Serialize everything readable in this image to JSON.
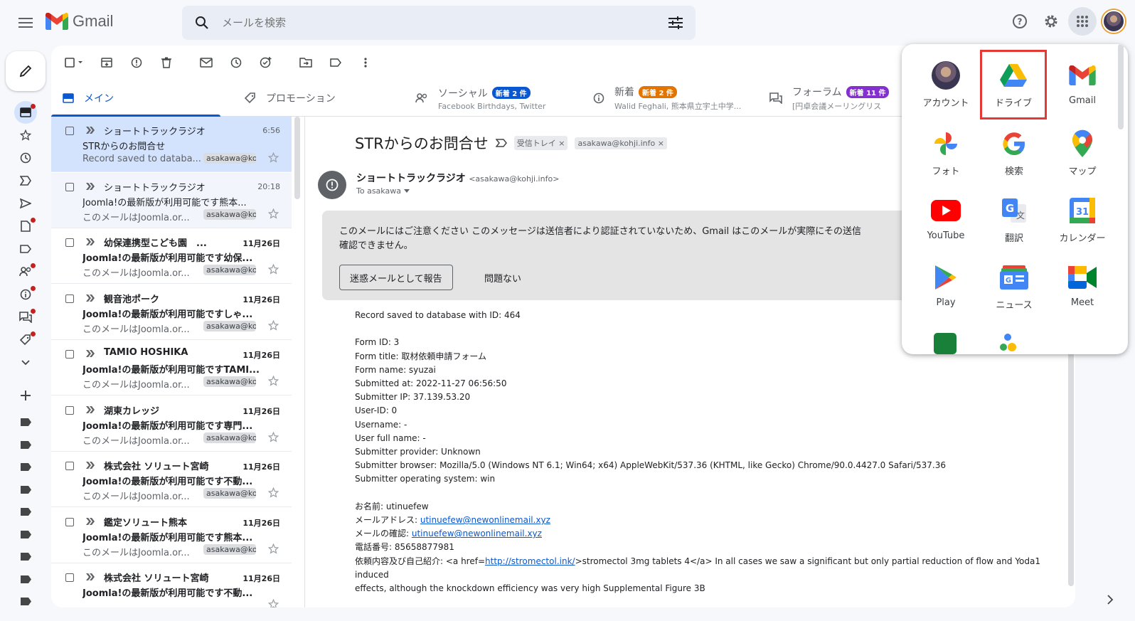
{
  "app": {
    "name": "Gmail"
  },
  "search": {
    "placeholder": "メールを検索"
  },
  "tabs": [
    {
      "title": "メイン",
      "sub": "",
      "badge": ""
    },
    {
      "title": "プロモーション",
      "sub": "",
      "badge": ""
    },
    {
      "title": "ソーシャル",
      "sub": "Facebook Birthdays, Twitter",
      "badge": "新着 2 件"
    },
    {
      "title": "新着",
      "sub": "Walid Feghali, 熊本県立宇土中学...",
      "badge": "新着 2 件"
    },
    {
      "title": "フォーラム",
      "sub": "[円卓会議メーリングリス",
      "badge": "新着 11 件"
    }
  ],
  "colors": {
    "badge_blue": "#0b57d0",
    "badge_orange": "#e37400",
    "badge_purple": "#8430ce",
    "highlight": "#e53935"
  },
  "emails": [
    {
      "sender": "ショートトラックラジオ",
      "time": "6:56",
      "subject": "STRからのお問合せ",
      "snippet": "Record saved to databa...",
      "chip": "asakawa@koji",
      "state": "selected"
    },
    {
      "sender": "ショートトラックラジオ",
      "time": "20:18",
      "subject": "Joomla!の最新版が利用可能です熊本...",
      "snippet": "このメールはJoomla.or...",
      "chip": "asakawa@koji",
      "state": "read"
    },
    {
      "sender": "幼保連携型こども園　...",
      "time": "11月26日",
      "subject": "Joomla!の最新版が利用可能です幼保...",
      "snippet": "このメールはJoomla.or...",
      "chip": "asakawa@koji",
      "state": "unread"
    },
    {
      "sender": "観音池ポーク",
      "time": "11月26日",
      "subject": "Joomla!の最新版が利用可能ですしゃ...",
      "snippet": "このメールはJoomla.or...",
      "chip": "asakawa@koji",
      "state": "unread"
    },
    {
      "sender": "TAMIO HOSHIKA",
      "time": "11月26日",
      "subject": "Joomla!の最新版が利用可能ですTAMI...",
      "snippet": "このメールはJoomla.or...",
      "chip": "asakawa@koji",
      "state": "unread"
    },
    {
      "sender": "湖東カレッジ",
      "time": "11月26日",
      "subject": "Joomla!の最新版が利用可能です専門...",
      "snippet": "このメールはJoomla.or...",
      "chip": "asakawa@koji",
      "state": "unread"
    },
    {
      "sender": "株式会社 ソリュート宮崎",
      "time": "11月26日",
      "subject": "Joomla!の最新版が利用可能です不動...",
      "snippet": "このメールはJoomla.or...",
      "chip": "asakawa@koji",
      "state": "unread"
    },
    {
      "sender": "鑑定ソリュート熊本",
      "time": "11月26日",
      "subject": "Joomla!の最新版が利用可能です熊本...",
      "snippet": "このメールはJoomla.or...",
      "chip": "asakawa@koji",
      "state": "unread"
    },
    {
      "sender": "株式会社 ソリュート宮崎",
      "time": "11月26日",
      "subject": "Joomla!の最新版が利用可能です不動...",
      "snippet": "",
      "chip": "",
      "state": "unread"
    }
  ],
  "message": {
    "title": "STRからのお問合せ",
    "labels": [
      "受信トレイ ×",
      "asakawa@kohji.info ×"
    ],
    "sender_name": "ショートトラックラジオ",
    "sender_email": "<asakawa@kohji.info>",
    "to": "To asakawa",
    "warning_line1": "このメールにはご注意ください このメッセージは送信者により認証されていないため、Gmail はこのメールが実際にその送信",
    "warning_line2": "確認できません。",
    "report_button": "迷惑メールとして報告",
    "ok_button": "問題ない",
    "body": {
      "l1": "Record saved to database with ID:  464",
      "l2": "Form ID: 3",
      "l3": "Form title: 取材依頼申請フォーム",
      "l4": "Form name: syuzai",
      "l5": "Submitted at: 2022-11-27 06:56:50",
      "l6": "Submitter IP: 37.139.53.20",
      "l7": "User-ID: 0",
      "l8": "Username: -",
      "l9": "User full name: -",
      "l10": "Submitter provider: Unknown",
      "l11": "Submitter browser: Mozilla/5.0 (Windows NT 6.1; Win64; x64) AppleWebKit/537.36 (KHTML, like Gecko) Chrome/90.0.4427.0 Safari/537.36",
      "l12": "Submitter operating system: win",
      "l13": "お名前: utinuefew",
      "l14_label": "メールアドレス: ",
      "l14_link": "utinuefew@newonlinemail.xyz",
      "l15_label": "メールの確認: ",
      "l15_link": "utinuefew@newonlinemail.xyz",
      "l16": "電話番号: 85658877981",
      "l17_a": "依頼内容及び自己紹介: <a href=",
      "l17_link": "http://stromectol.ink/",
      "l17_b": ">stromectol 3mg tablets 4</a> In all cases we saw a significant but only partial reduction of flow and Yoda1 induced",
      "l18": "effects, although the knockdown efficiency was very high Supplemental Figure 3B"
    }
  },
  "apps": [
    {
      "label": "アカウント",
      "icon": "account-icon"
    },
    {
      "label": "ドライブ",
      "icon": "drive-icon"
    },
    {
      "label": "Gmail",
      "icon": "gmail-icon"
    },
    {
      "label": "フォト",
      "icon": "photos-icon"
    },
    {
      "label": "検索",
      "icon": "google-search-icon"
    },
    {
      "label": "マップ",
      "icon": "maps-icon"
    },
    {
      "label": "YouTube",
      "icon": "youtube-icon"
    },
    {
      "label": "翻訳",
      "icon": "translate-icon"
    },
    {
      "label": "カレンダー",
      "icon": "calendar-icon"
    },
    {
      "label": "Play",
      "icon": "play-icon"
    },
    {
      "label": "ニュース",
      "icon": "news-icon"
    },
    {
      "label": "Meet",
      "icon": "meet-icon"
    }
  ],
  "calendar_day": "31"
}
